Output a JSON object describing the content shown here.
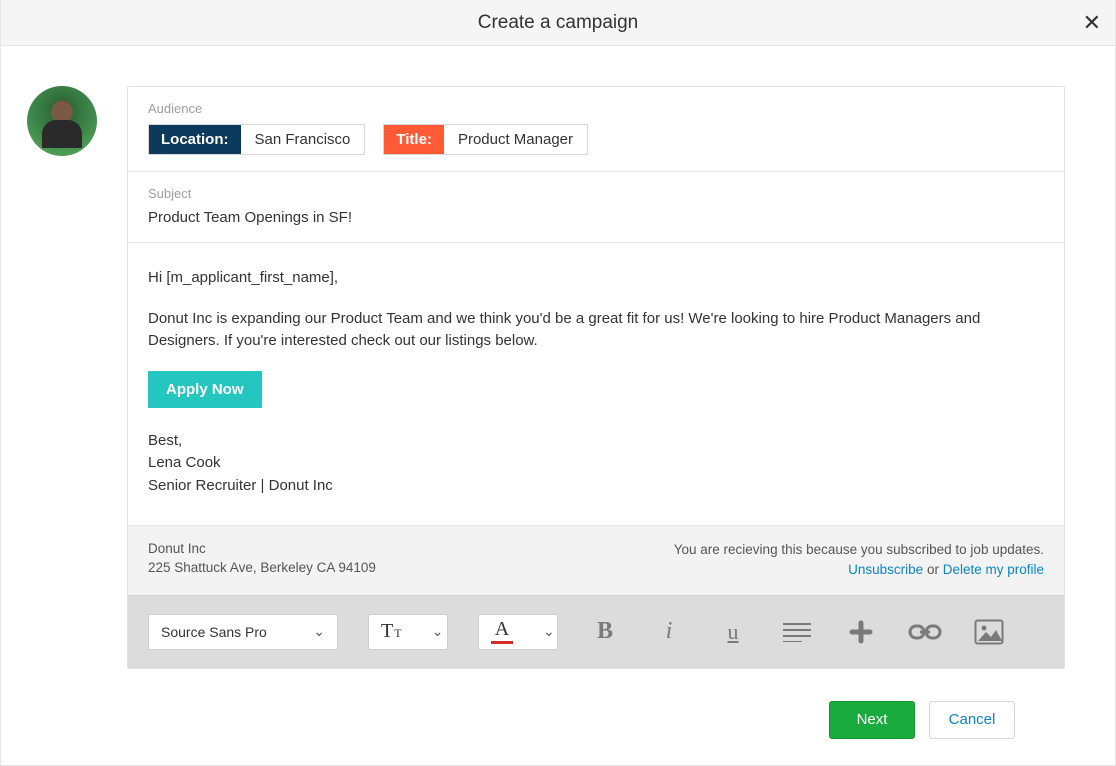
{
  "modal": {
    "title": "Create a campaign"
  },
  "audience": {
    "label": "Audience",
    "tags": {
      "location": {
        "key": "Location:",
        "value": "San Francisco"
      },
      "title": {
        "key": "Title:",
        "value": "Product Manager"
      }
    }
  },
  "subject": {
    "label": "Subject",
    "value": "Product Team Openings in SF!"
  },
  "body": {
    "greeting": "Hi [m_applicant_first_name],",
    "paragraph": "Donut Inc is expanding our Product Team and we think you'd be a great fit for us! We're looking to hire Product Managers and Designers. If you're interested check out our listings below.",
    "cta": "Apply Now",
    "signoff1": "Best,",
    "signoff2": "Lena Cook",
    "signoff3": "Senior Recruiter | Donut Inc"
  },
  "footer": {
    "company": "Donut Inc",
    "address": "225 Shattuck Ave, Berkeley CA 94109",
    "notice": "You are recieving this because you subscribed to job updates.",
    "unsubscribe": "Unsubscribe",
    "or": " or ",
    "delete": "Delete my profile"
  },
  "toolbar": {
    "font": "Source Sans Pro"
  },
  "actions": {
    "next": "Next",
    "cancel": "Cancel"
  },
  "colors": {
    "location_tag": "#0b3a5d",
    "title_tag": "#ff5a36",
    "cta": "#26c6c0",
    "primary": "#1aab3e",
    "link": "#0a84c6"
  }
}
